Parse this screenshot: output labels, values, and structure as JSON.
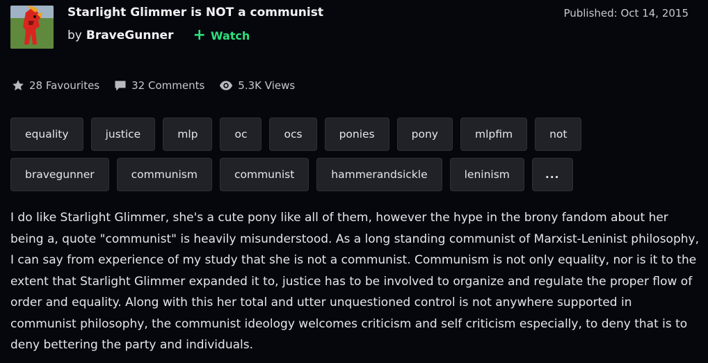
{
  "deviation": {
    "title": "Starlight Glimmer is NOT a communist",
    "by_label": "by",
    "author": "BraveGunner",
    "watch_label": "Watch",
    "published": "Published: Oct 14, 2015"
  },
  "stats": {
    "favourites": "28 Favourites",
    "comments": "32 Comments",
    "views": "5.3K Views"
  },
  "tags": [
    "equality",
    "justice",
    "mlp",
    "oc",
    "ocs",
    "ponies",
    "pony",
    "mlpfim",
    "not",
    "bravegunner",
    "communism",
    "communist",
    "hammerandsickle",
    "leninism"
  ],
  "more_tags_label": "...",
  "description": "I do like Starlight Glimmer, she's a cute pony like all of them, however the hype in the brony fandom about her being a, quote \"communist\" is heavily misunderstood. As a long standing communist of Marxist-Leninist philosophy, I can say from experience of my study that she is not a communist. Communism is not only equality, nor is it to the extent that Starlight Glimmer expanded it to, justice has to be involved to organize and regulate the proper flow of order and equality. Along with this her total and utter unquestioned control is not anywhere supported in communist philosophy, the communist ideology welcomes criticism and self criticism especially, to deny that is to deny bettering the party and individuals.",
  "colors": {
    "background": "#06070d",
    "accent_watch": "#2ee07e",
    "tag_bg": "#212228"
  }
}
